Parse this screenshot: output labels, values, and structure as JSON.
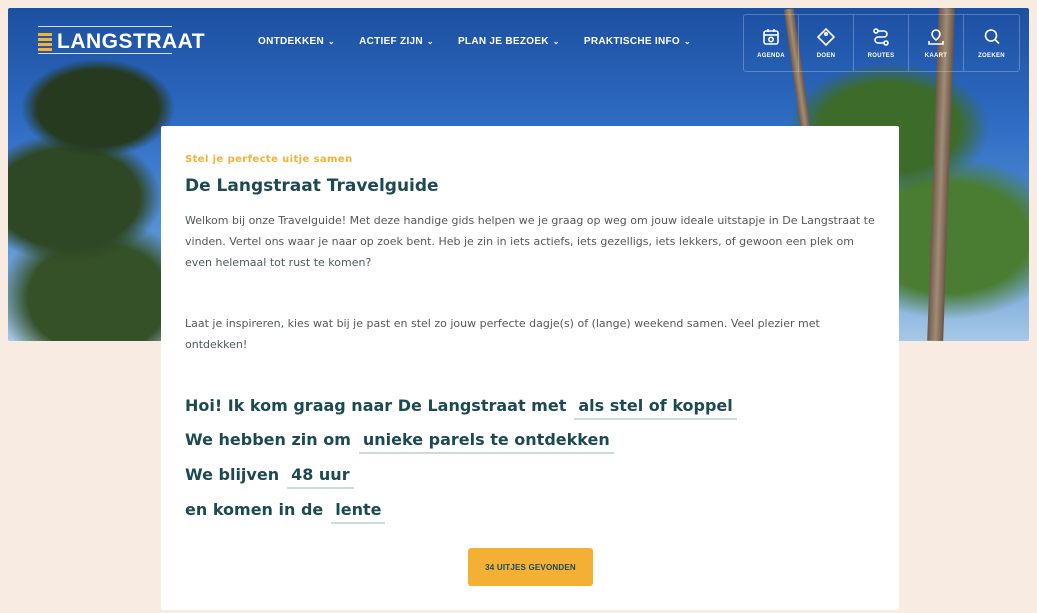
{
  "header": {
    "logo_text": "LANGSTRAAT",
    "nav": [
      {
        "label": "ONTDEKKEN"
      },
      {
        "label": "ACTIEF ZIJN"
      },
      {
        "label": "PLAN JE BEZOEK"
      },
      {
        "label": "PRAKTISCHE INFO"
      }
    ],
    "tools": [
      {
        "label": "AGENDA",
        "icon": "calendar-icon"
      },
      {
        "label": "DOEN",
        "icon": "ticket-icon"
      },
      {
        "label": "ROUTES",
        "icon": "route-icon"
      },
      {
        "label": "KAART",
        "icon": "map-icon"
      },
      {
        "label": "ZOEKEN",
        "icon": "search-icon"
      }
    ]
  },
  "card": {
    "eyebrow": "Stel je perfecte uitje samen",
    "title": "De Langstraat Travelguide",
    "intro": "Welkom bij onze Travelguide! Met deze handige gids helpen we je graag op weg om jouw ideale uitstapje in De Langstraat te vinden. Vertel ons waar je naar op zoek bent. Heb je zin in iets actiefs, iets gezelligs, iets lekkers, of gewoon een plek om even helemaal tot rust te komen?",
    "intro2": "Laat je inspireren, kies wat bij je past en stel zo jouw perfecte dagje(s) of (lange) weekend samen. Veel plezier met ontdekken!",
    "sentences": [
      {
        "prefix": "Hoi! Ik kom graag naar De Langstraat met",
        "value": "als stel of koppel"
      },
      {
        "prefix": "We hebben zin om",
        "value": "unieke parels te ontdekken"
      },
      {
        "prefix": "We blijven",
        "value": "48 uur"
      },
      {
        "prefix": "en komen in de",
        "value": "lente"
      }
    ],
    "cta": "34 UITJES GEVONDEN"
  },
  "colors": {
    "accent": "#f4b035",
    "heading": "#1d4a52",
    "background": "#f7ebe2"
  }
}
